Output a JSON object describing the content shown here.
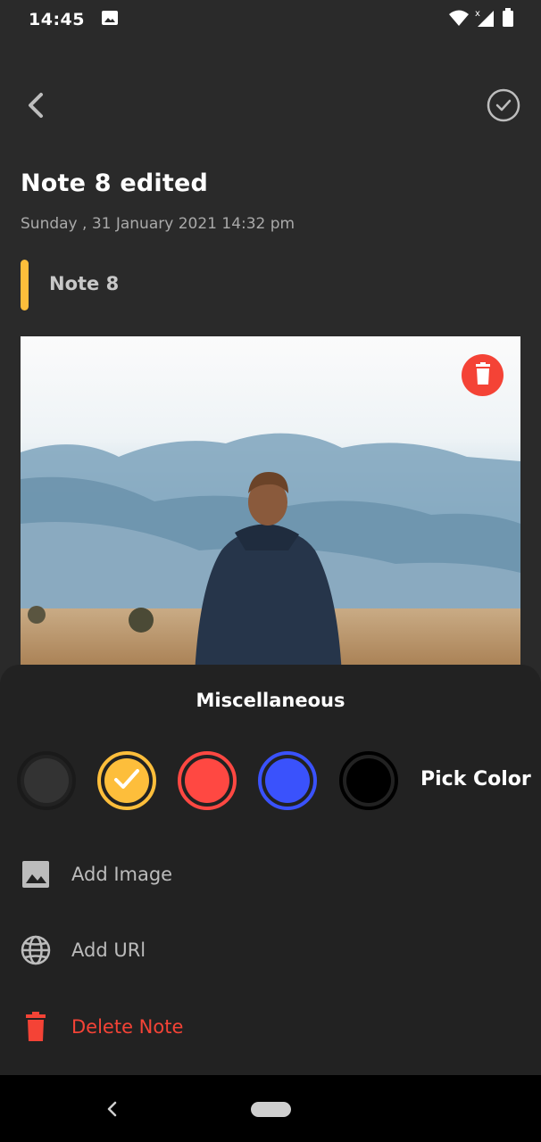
{
  "status_bar": {
    "time": "14:45",
    "icons": [
      "image-icon",
      "wifi-icon",
      "signal-icon",
      "battery-icon"
    ]
  },
  "header": {
    "back_icon": "chevron-left-icon",
    "save_icon": "check-circle-icon"
  },
  "note": {
    "title": "Note 8 edited",
    "date": "Sunday , 31 January 2021 14:32 pm",
    "subtitle": "Note 8",
    "indicator_color": "#fdbe3b",
    "image_delete_icon": "trash-icon"
  },
  "miscellaneous": {
    "title": "Miscellaneous",
    "colors": [
      {
        "hex": "#333333",
        "selected": false
      },
      {
        "hex": "#fdbe3b",
        "selected": true
      },
      {
        "hex": "#ff4842",
        "selected": false
      },
      {
        "hex": "#3a52fc",
        "selected": false
      },
      {
        "hex": "#000000",
        "selected": false
      }
    ],
    "pick_color_label": "Pick Color",
    "add_image_label": "Add Image",
    "add_url_label": "Add URl",
    "delete_note_label": "Delete Note"
  },
  "colors": {
    "background": "#2a2a2a",
    "sheet": "#222222",
    "accent_yellow": "#fdbe3b",
    "danger": "#f44336"
  }
}
